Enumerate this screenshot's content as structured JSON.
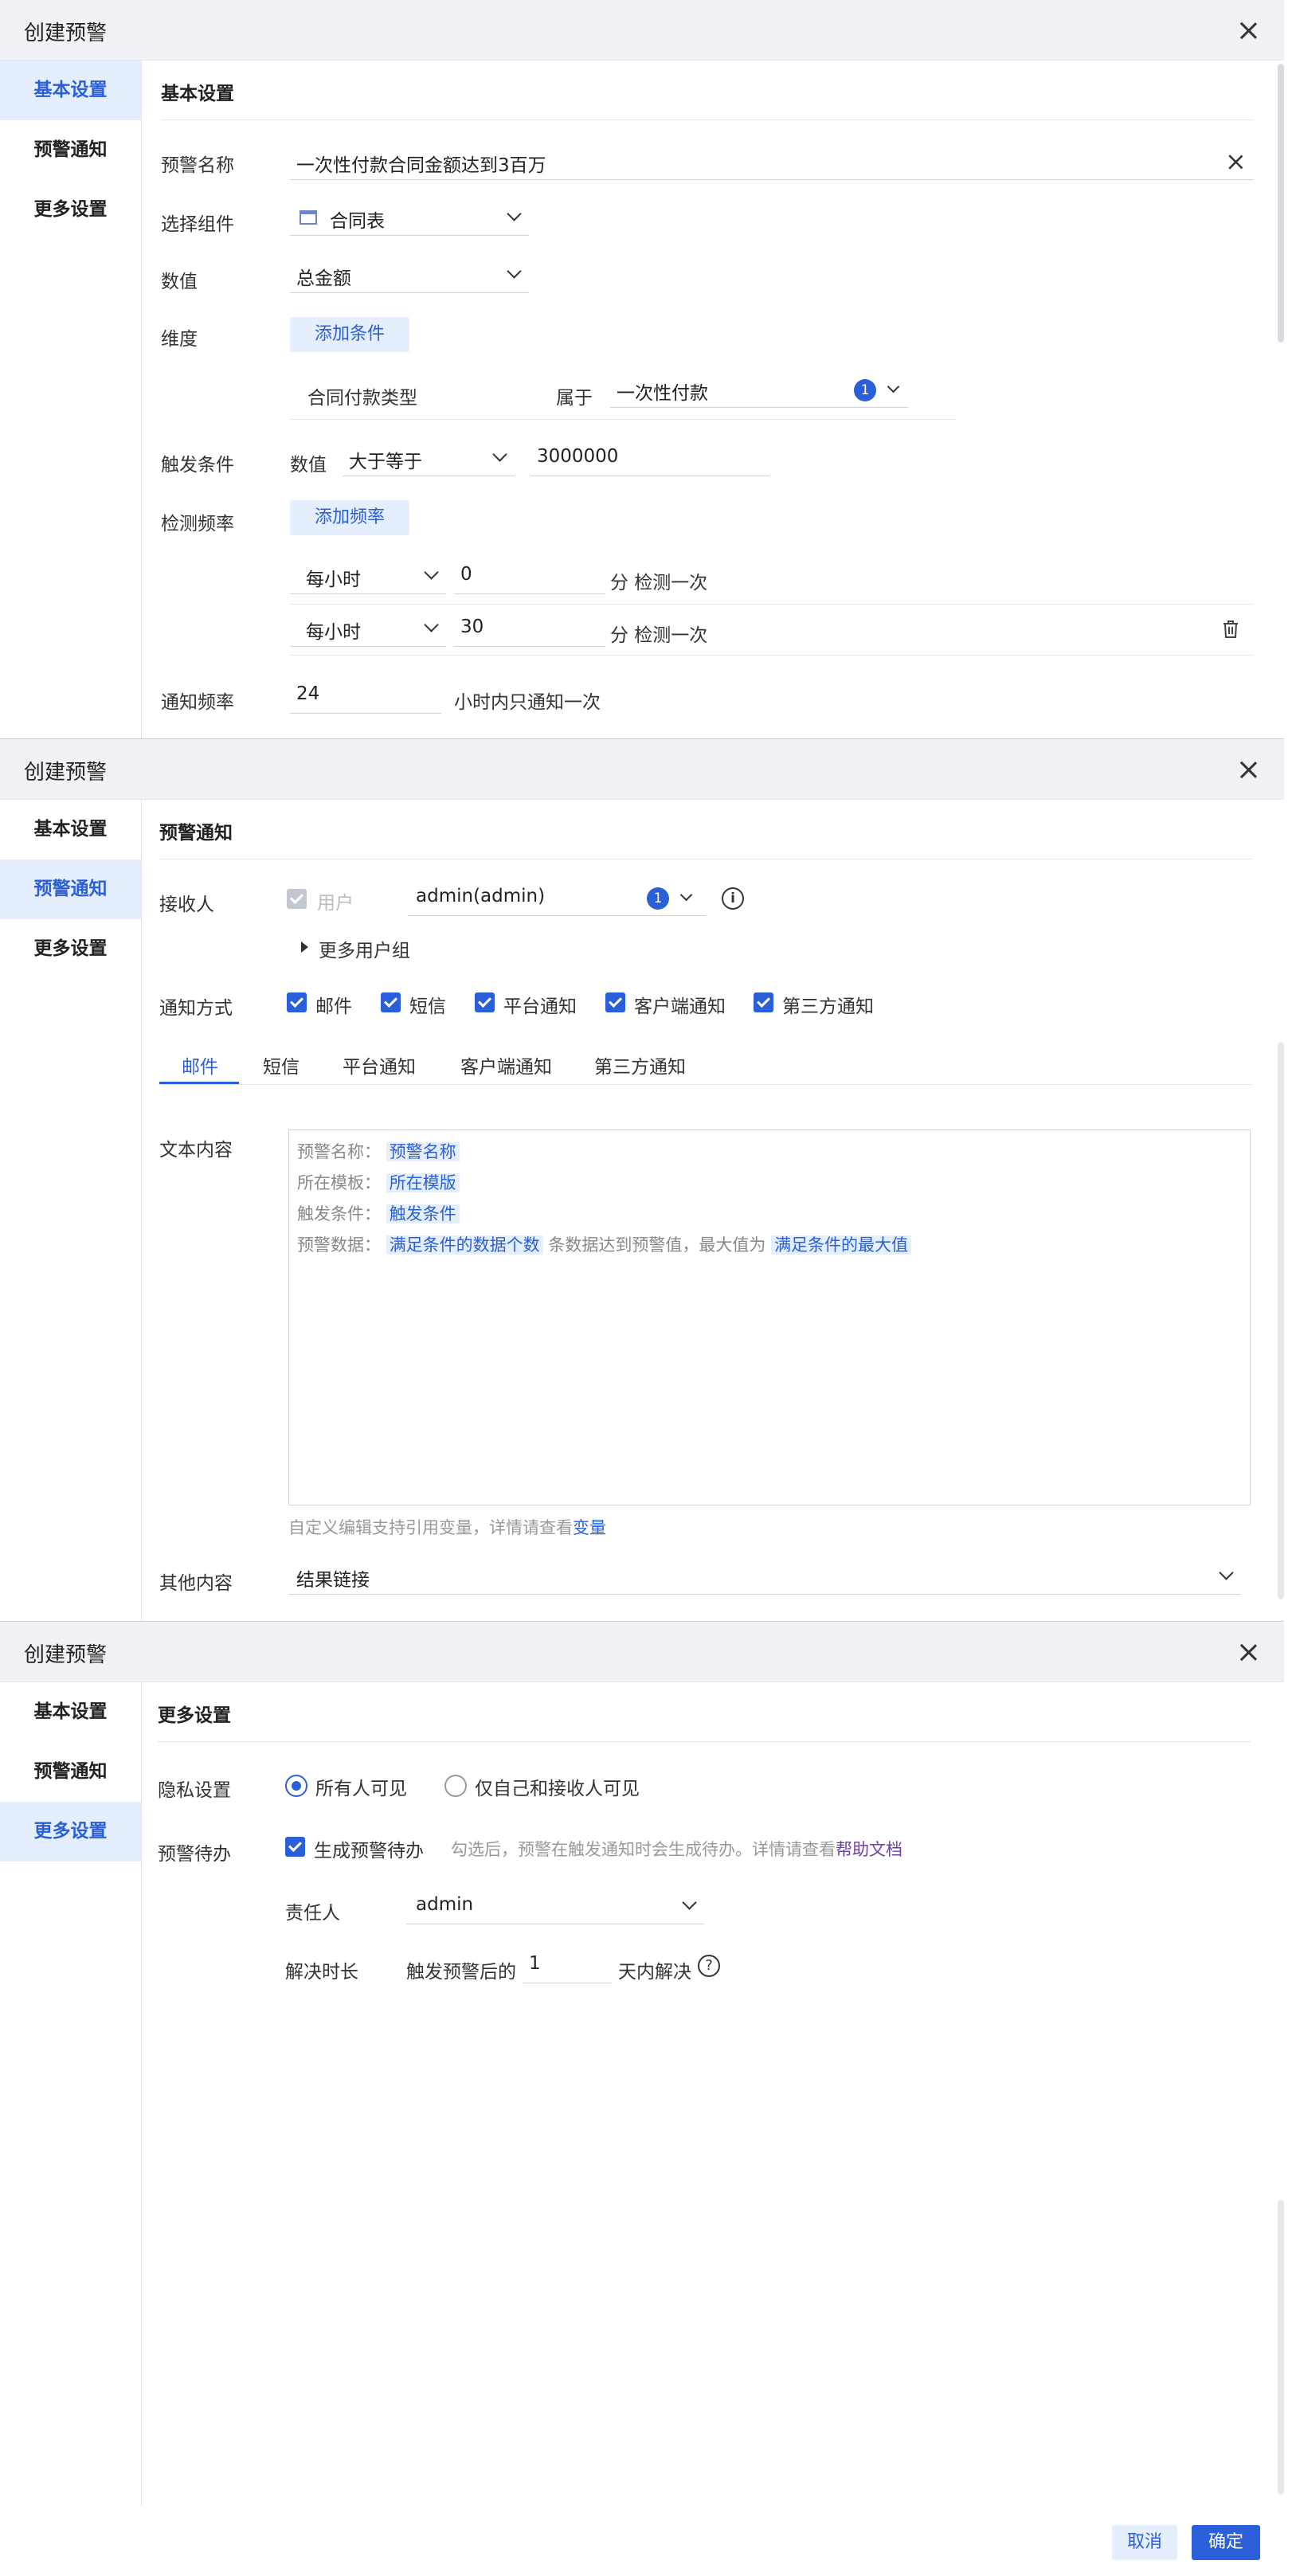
{
  "dialog_title": "创建预警",
  "nav": {
    "basic": "基本设置",
    "notice": "预警通知",
    "more": "更多设置"
  },
  "basic": {
    "section": "基本设置",
    "name_label": "预警名称",
    "name_value": "一次性付款合同金额达到3百万",
    "component_label": "选择组件",
    "component_value": "合同表",
    "value_label": "数值",
    "value_value": "总金额",
    "dimension_label": "维度",
    "add_condition": "添加条件",
    "cond_field": "合同付款类型",
    "cond_op": "属于",
    "cond_value": "一次性付款",
    "cond_count": "1",
    "trigger_label": "触发条件",
    "trigger_prefix": "数值",
    "trigger_op": "大于等于",
    "trigger_value": "3000000",
    "freq_label": "检测频率",
    "add_freq": "添加频率",
    "freq_rows": [
      {
        "period": "每小时",
        "min": "0",
        "suffix": "分 检测一次"
      },
      {
        "period": "每小时",
        "min": "30",
        "suffix": "分 检测一次"
      }
    ],
    "notify_freq_label": "通知频率",
    "notify_freq_value": "24",
    "notify_freq_suffix": "小时内只通知一次"
  },
  "notice": {
    "section": "预警通知",
    "receiver_label": "接收人",
    "user_cb": "用户",
    "receiver_value": "admin(admin)",
    "receiver_count": "1",
    "more_groups": "更多用户组",
    "method_label": "通知方式",
    "methods": [
      "邮件",
      "短信",
      "平台通知",
      "客户端通知",
      "第三方通知"
    ],
    "tabs": [
      "邮件",
      "短信",
      "平台通知",
      "客户端通知",
      "第三方通知"
    ],
    "text_label": "文本内容",
    "lines": [
      {
        "label": "预警名称：",
        "var": "预警名称"
      },
      {
        "label": "所在模板：",
        "var": "所在模版"
      },
      {
        "label": "触发条件：",
        "var": "触发条件"
      },
      {
        "label": "预警数据：",
        "var": "满足条件的数据个数",
        "mid": "条数据达到预警值，最大值为",
        "var2": "满足条件的最大值"
      }
    ],
    "hint": "自定义编辑支持引用变量，详情请查看",
    "hint_link": "变量",
    "other_label": "其他内容",
    "other_value": "结果链接"
  },
  "more": {
    "section": "更多设置",
    "privacy_label": "隐私设置",
    "privacy_all": "所有人可见",
    "privacy_self": "仅自己和接收人可见",
    "todo_label": "预警待办",
    "todo_cb": "生成预警待办",
    "todo_hint": "勾选后，预警在触发通知时会生成待办。详情请查看",
    "todo_link": "帮助文档",
    "owner_label": "责任人",
    "owner_value": "admin",
    "duration_label": "解决时长",
    "duration_prefix": "触发预警后的",
    "duration_value": "1",
    "duration_suffix": "天内解决"
  },
  "footer": {
    "cancel": "取消",
    "ok": "确定"
  }
}
